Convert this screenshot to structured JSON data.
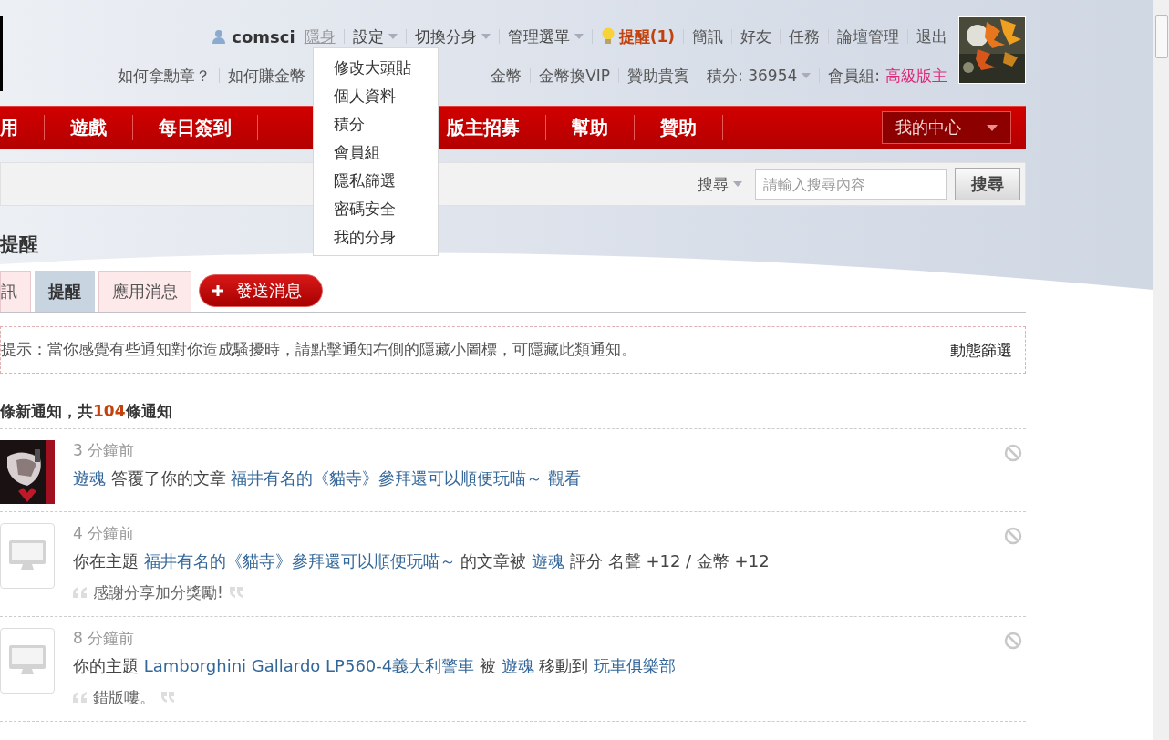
{
  "user_bar": {
    "username": "comsci",
    "invisible_link": "隱身",
    "menus": [
      {
        "label": "設定",
        "dropdown": true
      },
      {
        "label": "切換分身",
        "dropdown": true
      },
      {
        "label": "管理選單",
        "dropdown": true
      }
    ],
    "notice_link": "提醒(1)",
    "links": [
      "簡訊",
      "好友",
      "任務",
      "論壇管理",
      "退出"
    ],
    "settings_menu": [
      "修改大頭貼",
      "個人資料",
      "積分",
      "會員組",
      "隱私篩選",
      "密碼安全",
      "我的分身"
    ]
  },
  "info_bar": {
    "left_links": [
      "如何拿勳章？",
      "如何賺金幣"
    ],
    "right_links": [
      "金幣",
      "金幣換VIP",
      "贊助貴賓"
    ],
    "points": "積分: 36954",
    "group_label": "會員組:",
    "group_value": "高級版主"
  },
  "nav": {
    "left_items": [
      "用",
      "遊戲",
      "每日簽到"
    ],
    "right_items": [
      "版主招募",
      "幫助",
      "贊助"
    ],
    "my_center": "我的中心"
  },
  "search": {
    "scope": "搜尋",
    "placeholder": "請輸入搜尋內容",
    "button": "搜尋"
  },
  "page_title": "提醒",
  "tabs": [
    {
      "label": "訊",
      "selected": false
    },
    {
      "label": "提醒",
      "selected": true
    },
    {
      "label": "應用消息",
      "selected": false
    }
  ],
  "send_button": "發送消息",
  "hint": {
    "text": "提示：當你感覺有些通知對你造成騷擾時，請點擊通知右側的隱藏小圖標，可隱藏此類通知。",
    "filter_link": "動態篩選"
  },
  "summary": {
    "prefix": "條新通知，共",
    "count": "104",
    "suffix": "條通知"
  },
  "notifications": [
    {
      "time": "3 分鐘前",
      "parts": [
        {
          "kind": "link",
          "text": "遊魂"
        },
        {
          "kind": "text",
          "text": "答覆了你的文章"
        },
        {
          "kind": "link",
          "text": "福井有名的《貓寺》參拜還可以順便玩喵～"
        },
        {
          "kind": "link",
          "text": "觀看"
        }
      ]
    },
    {
      "kind": "default",
      "time": "4 分鐘前",
      "parts": [
        {
          "kind": "text",
          "text": "你在主題"
        },
        {
          "kind": "link",
          "text": "福井有名的《貓寺》參拜還可以順便玩喵～"
        },
        {
          "kind": "text",
          "text": "的文章被"
        },
        {
          "kind": "link",
          "text": "遊魂"
        },
        {
          "kind": "text",
          "text": "評分 名聲 +12 / 金幣 +12"
        }
      ],
      "quote": "感謝分享加分獎勵!"
    },
    {
      "kind": "default",
      "time": "8 分鐘前",
      "parts": [
        {
          "kind": "text",
          "text": "你的主題"
        },
        {
          "kind": "link",
          "text": "Lamborghini Gallardo LP560-4義大利警車"
        },
        {
          "kind": "text",
          "text": "被"
        },
        {
          "kind": "link",
          "text": "遊魂"
        },
        {
          "kind": "text",
          "text": "移動到"
        },
        {
          "kind": "link",
          "text": "玩車俱樂部"
        }
      ],
      "quote": "錯版嘍。"
    }
  ]
}
